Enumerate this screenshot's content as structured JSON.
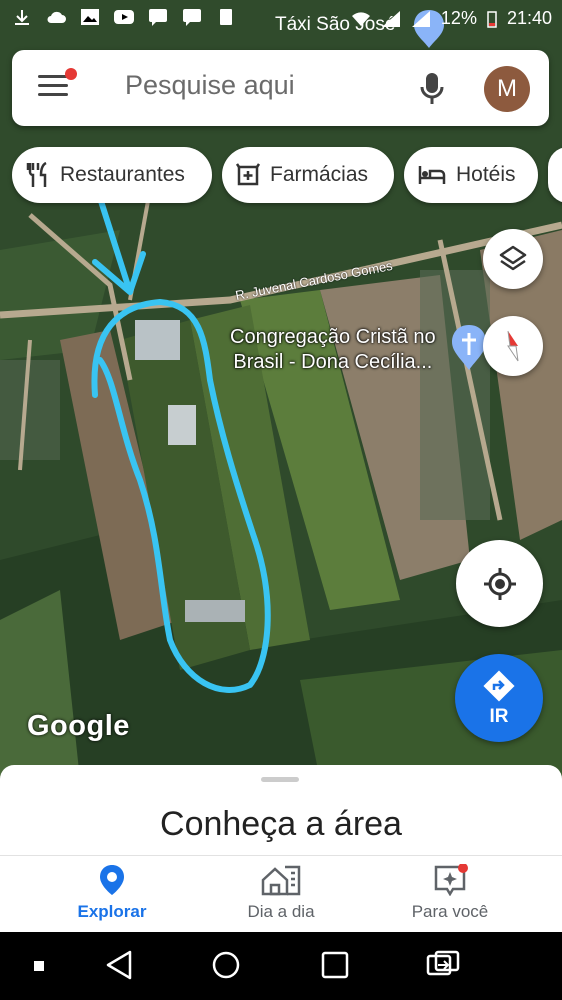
{
  "status_bar": {
    "battery": "12%",
    "time": "21:40",
    "overlay_text": "Táxi São José"
  },
  "search": {
    "placeholder": "Pesquise aqui",
    "avatar_initial": "M"
  },
  "chips": [
    {
      "label": "Restaurantes",
      "icon": "fork-knife-icon"
    },
    {
      "label": "Farmácias",
      "icon": "pharmacy-icon"
    },
    {
      "label": "Hotéis",
      "icon": "bed-icon"
    }
  ],
  "map": {
    "road_label": "R. Juvenal Cardoso Gomes",
    "place_label_line1": "Congregação Cristã no",
    "place_label_line2": "Brasil - Dona Cecília...",
    "logo": "Google",
    "go_label": "IR",
    "annotation_color": "#39c4f2"
  },
  "sheet": {
    "title": "Conheça a área"
  },
  "nav": [
    {
      "label": "Explorar",
      "active": true,
      "color": "#1a73e8"
    },
    {
      "label": "Dia a dia",
      "active": false
    },
    {
      "label": "Para você",
      "active": false
    }
  ]
}
